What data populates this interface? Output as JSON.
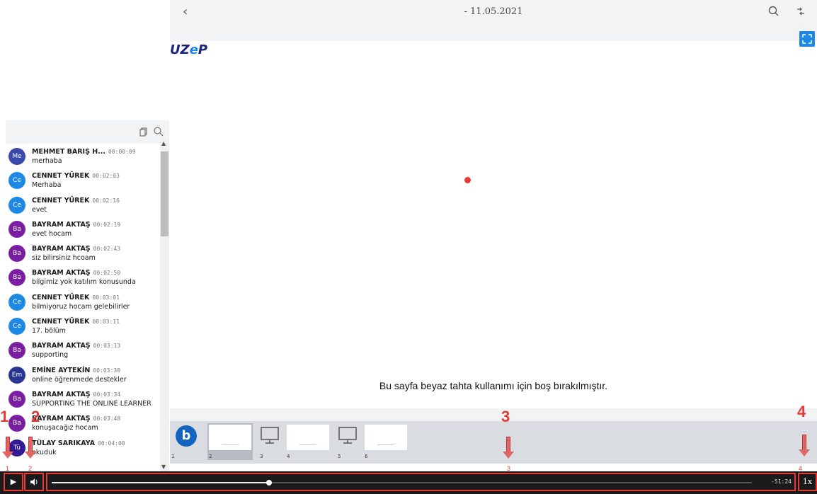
{
  "header": {
    "back_label": "‹",
    "title": "- 11.05.2021",
    "search_icon": "search-icon",
    "swap_icon": "swap-icon"
  },
  "logo": {
    "part1": "UZ",
    "part2": "e",
    "part3": "P"
  },
  "slide": {
    "text": "Bu sayfa beyaz tahta kullanımı için boş bırakılmıştır."
  },
  "chat": {
    "messages": [
      {
        "initials": "Me",
        "name": "MEHMET BARIŞ H...",
        "time": "00:00:09",
        "text": "merhaba",
        "color": "#3949ab"
      },
      {
        "initials": "Ce",
        "name": "CENNET YÜREK",
        "time": "00:02:03",
        "text": "Merhaba",
        "color": "#1e88e5"
      },
      {
        "initials": "Ce",
        "name": "CENNET YÜREK",
        "time": "00:02:16",
        "text": "evet",
        "color": "#1e88e5"
      },
      {
        "initials": "Ba",
        "name": "BAYRAM AKTAŞ",
        "time": "00:02:19",
        "text": "evet hocam",
        "color": "#7b1fa2"
      },
      {
        "initials": "Ba",
        "name": "BAYRAM AKTAŞ",
        "time": "00:02:43",
        "text": "siz bilirsiniz hcoam",
        "color": "#7b1fa2"
      },
      {
        "initials": "Ba",
        "name": "BAYRAM AKTAŞ",
        "time": "00:02:50",
        "text": "bilgimiz yok katılım konusunda",
        "color": "#7b1fa2"
      },
      {
        "initials": "Ce",
        "name": "CENNET YÜREK",
        "time": "00:03:01",
        "text": "bilmiyoruz hocam gelebilirler",
        "color": "#1e88e5"
      },
      {
        "initials": "Ce",
        "name": "CENNET YÜREK",
        "time": "00:03:11",
        "text": "17. bölüm",
        "color": "#1e88e5"
      },
      {
        "initials": "Ba",
        "name": "BAYRAM AKTAŞ",
        "time": "00:03:13",
        "text": "supporting",
        "color": "#7b1fa2"
      },
      {
        "initials": "Em",
        "name": "EMİNE AYTEKİN",
        "time": "00:03:30",
        "text": "online öğrenmede destekler",
        "color": "#283593"
      },
      {
        "initials": "Ba",
        "name": "BAYRAM AKTAŞ",
        "time": "00:03:34",
        "text": "SUPPORTING THE ONLINE LEARNER",
        "color": "#7b1fa2"
      },
      {
        "initials": "Ba",
        "name": "BAYRAM AKTAŞ",
        "time": "00:03:48",
        "text": "konuşacağız hocam",
        "color": "#7b1fa2"
      },
      {
        "initials": "Tü",
        "name": "TÜLAY SARIKAYA",
        "time": "00:04:00",
        "text": "okuduk",
        "color": "#311b92"
      }
    ]
  },
  "thumbnails": [
    {
      "num": "1",
      "kind": "logo"
    },
    {
      "num": "2",
      "kind": "slide",
      "active": true
    },
    {
      "num": "3",
      "kind": "screen"
    },
    {
      "num": "4",
      "kind": "slide"
    },
    {
      "num": "5",
      "kind": "screen"
    },
    {
      "num": "6",
      "kind": "slide"
    }
  ],
  "player": {
    "play_label": "▶",
    "volume_label": "🔊",
    "remaining": "-51:24",
    "speed": "1x",
    "progress_fraction": 0.31
  },
  "annotations": {
    "big": [
      "1",
      "2",
      "3",
      "4"
    ],
    "small": [
      "1",
      "2",
      "3",
      "4"
    ]
  }
}
